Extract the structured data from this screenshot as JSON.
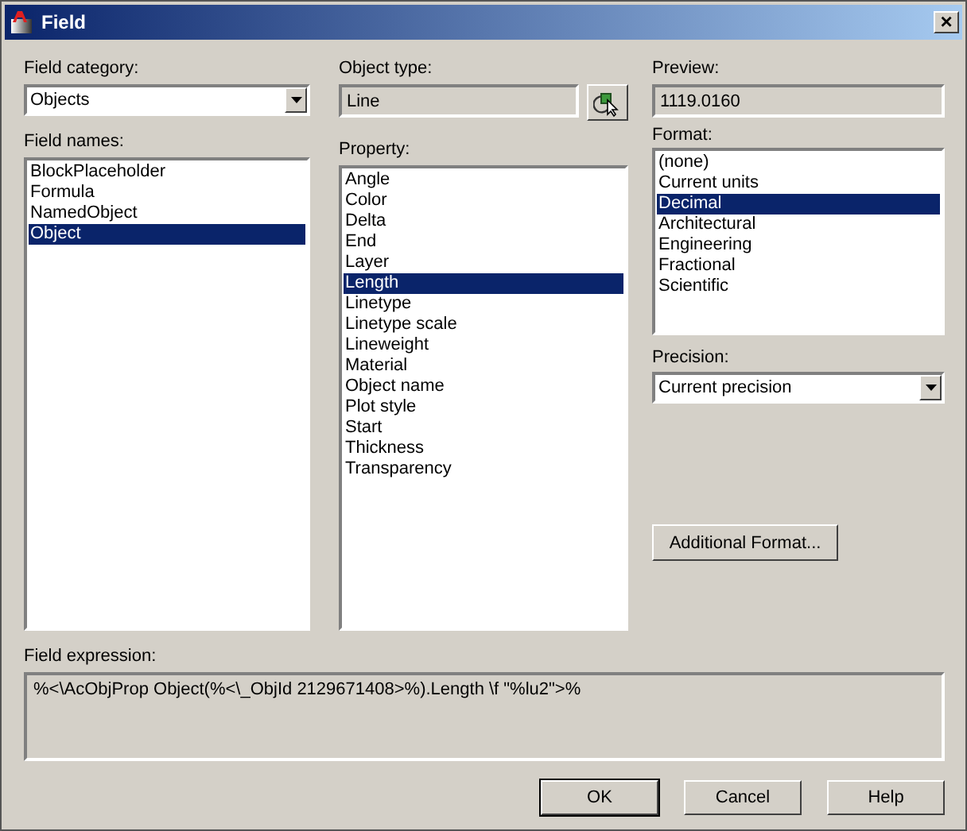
{
  "window": {
    "title": "Field",
    "close": "×"
  },
  "field_category": {
    "label": "Field category:",
    "value": "Objects"
  },
  "field_names": {
    "label": "Field names:",
    "items": [
      {
        "text": "BlockPlaceholder",
        "selected": false
      },
      {
        "text": "Formula",
        "selected": false
      },
      {
        "text": "NamedObject",
        "selected": false
      },
      {
        "text": "Object",
        "selected": true
      }
    ]
  },
  "object_type": {
    "label": "Object type:",
    "value": "Line"
  },
  "property": {
    "label": "Property:",
    "items": [
      {
        "text": "Angle",
        "selected": false
      },
      {
        "text": "Color",
        "selected": false
      },
      {
        "text": "Delta",
        "selected": false
      },
      {
        "text": "End",
        "selected": false
      },
      {
        "text": "Layer",
        "selected": false
      },
      {
        "text": "Length",
        "selected": true
      },
      {
        "text": "Linetype",
        "selected": false
      },
      {
        "text": "Linetype scale",
        "selected": false
      },
      {
        "text": "Lineweight",
        "selected": false
      },
      {
        "text": "Material",
        "selected": false
      },
      {
        "text": "Object name",
        "selected": false
      },
      {
        "text": "Plot style",
        "selected": false
      },
      {
        "text": "Start",
        "selected": false
      },
      {
        "text": "Thickness",
        "selected": false
      },
      {
        "text": "Transparency",
        "selected": false
      }
    ]
  },
  "preview": {
    "label": "Preview:",
    "value": "1119.0160"
  },
  "format": {
    "label": "Format:",
    "items": [
      {
        "text": "(none)",
        "selected": false
      },
      {
        "text": "Current units",
        "selected": false
      },
      {
        "text": "Decimal",
        "selected": true
      },
      {
        "text": "Architectural",
        "selected": false
      },
      {
        "text": "Engineering",
        "selected": false
      },
      {
        "text": "Fractional",
        "selected": false
      },
      {
        "text": "Scientific",
        "selected": false
      }
    ]
  },
  "precision": {
    "label": "Precision:",
    "value": "Current precision"
  },
  "additional_format_button": "Additional Format...",
  "field_expression": {
    "label": "Field expression:",
    "value": "%<\\AcObjProp Object(%<\\_ObjId 2129671408>%).Length \\f \"%lu2\">%"
  },
  "buttons": [
    {
      "label": "OK",
      "default": true
    },
    {
      "label": "Cancel",
      "default": false
    },
    {
      "label": "Help",
      "default": false
    }
  ]
}
